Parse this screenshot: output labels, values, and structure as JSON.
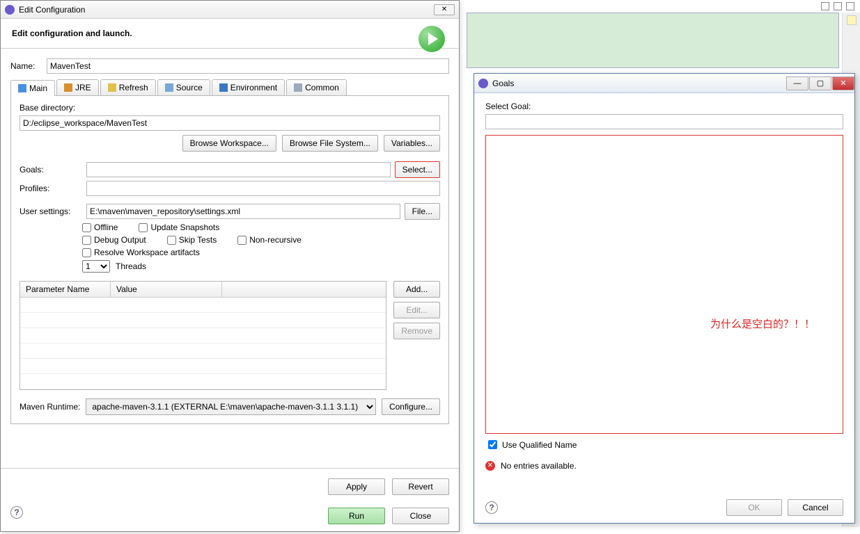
{
  "bg": {},
  "dlg1": {
    "title": "Edit Configuration",
    "banner": "Edit configuration and launch.",
    "name_label": "Name:",
    "name_value": "MavenTest",
    "tabs": {
      "main": "Main",
      "jre": "JRE",
      "refresh": "Refresh",
      "source": "Source",
      "env": "Environment",
      "common": "Common"
    },
    "basedir_label": "Base directory:",
    "basedir_value": "D:/eclipse_workspace/MavenTest",
    "browse_ws": "Browse Workspace...",
    "browse_fs": "Browse File System...",
    "variables": "Variables...",
    "goals_label": "Goals:",
    "goals_value": "",
    "select": "Select...",
    "profiles_label": "Profiles:",
    "profiles_value": "",
    "usersettings_label": "User settings:",
    "usersettings_value": "E:\\maven\\maven_repository\\settings.xml",
    "file": "File...",
    "chk": {
      "offline": "Offline",
      "update": "Update Snapshots",
      "debug": "Debug Output",
      "skip": "Skip Tests",
      "nonrec": "Non-recursive",
      "resolve": "Resolve Workspace artifacts"
    },
    "threads_value": "1",
    "threads_label": "Threads",
    "table": {
      "col1": "Parameter Name",
      "col2": "Value",
      "add": "Add...",
      "edit": "Edit...",
      "remove": "Remove"
    },
    "runtime_label": "Maven Runtime:",
    "runtime_value": "apache-maven-3.1.1 (EXTERNAL E:\\maven\\apache-maven-3.1.1 3.1.1)",
    "configure": "Configure...",
    "apply": "Apply",
    "revert": "Revert",
    "run": "Run",
    "close": "Close"
  },
  "dlg2": {
    "title": "Goals",
    "select_label": "Select Goal:",
    "select_value": "",
    "annotation": "为什么是空白的？！！",
    "qualified": "Use Qualified Name",
    "error": "No entries available.",
    "ok": "OK",
    "cancel": "Cancel"
  }
}
